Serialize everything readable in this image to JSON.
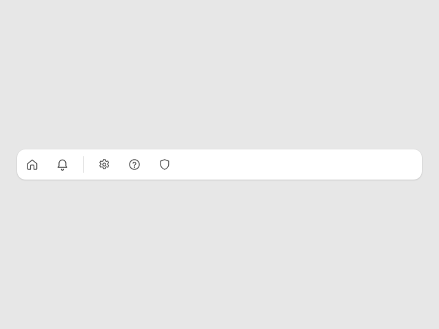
{
  "toolbar": {
    "icon_color": "#555555",
    "background": "#ffffff",
    "page_background": "#e7e7e7",
    "items": [
      {
        "icon": "home-icon"
      },
      {
        "icon": "bell-icon"
      },
      {
        "separator": true
      },
      {
        "icon": "gear-icon"
      },
      {
        "icon": "help-circle-icon"
      },
      {
        "icon": "shield-icon"
      }
    ]
  }
}
